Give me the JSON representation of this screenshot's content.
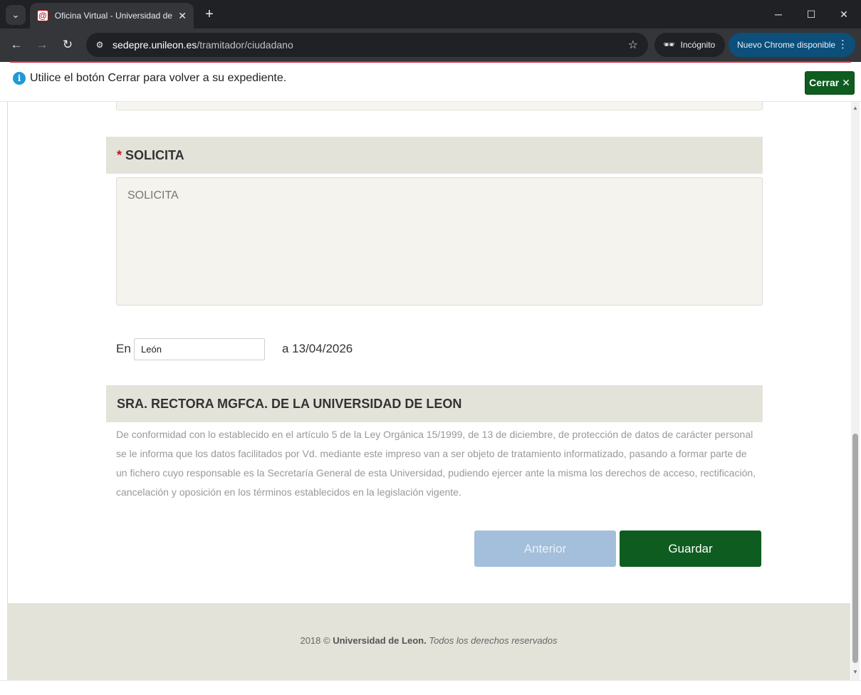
{
  "browser": {
    "tab_title": "Oficina Virtual - Universidad de León",
    "url_host": "sedepre.unileon.es",
    "url_path": "/tramitador/ciudadano",
    "incognito_label": "Incógnito",
    "update_label": "Nuevo Chrome disponible"
  },
  "notice": {
    "text": "Utilice el botón Cerrar para volver a su expediente.",
    "close_label": "Cerrar ✕"
  },
  "form": {
    "solicita_header": "SOLICITA",
    "required_mark": "*",
    "solicita_placeholder": "SOLICITA",
    "en_label": "En",
    "en_value": "León",
    "date_text": "a 13/04/2026",
    "recipient_header": "SRA. RECTORA MGFCA. DE LA UNIVERSIDAD DE LEON",
    "legal_text": "De conformidad con lo establecido en el artículo 5 de la Ley Orgánica 15/1999, de 13 de diciembre, de protección de datos de carácter personal se le informa que los datos facilitados por Vd. mediante este impreso van a ser objeto de tratamiento informatizado, pasando a formar parte de un fichero cuyo responsable es la Secretaría General de esta Universidad, pudiendo ejercer ante la misma los derechos de acceso, rectificación, cancelación y oposición en los términos establecidos en la legislación vigente.",
    "prev_label": "Anterior",
    "save_label": "Guardar"
  },
  "footer": {
    "year": "2018 ©",
    "org": "Universidad de Leon.",
    "rights": "Todos los derechos reservados"
  },
  "colors": {
    "primary_green": "#0e5c1f",
    "disabled_blue": "#a3bfdb",
    "header_bg": "#e4e3da",
    "info_blue": "#1e9ad6"
  }
}
